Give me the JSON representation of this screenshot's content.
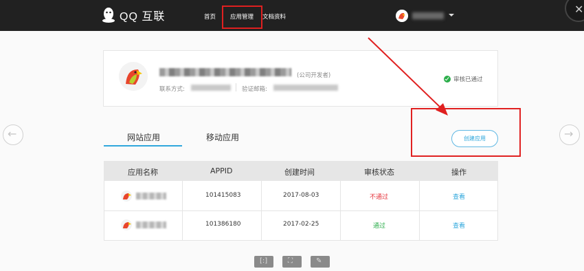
{
  "header": {
    "logo_text": "QQ 互联",
    "nav": {
      "home": "首页",
      "app_manage": "应用管理",
      "docs": "文档资料"
    }
  },
  "profile": {
    "developer_type": "(公司开发者)",
    "contact_label": "联系方式:",
    "email_label": "验证邮箱:",
    "verified_text": "审核已通过"
  },
  "tabs": {
    "web": "网站应用",
    "mobile": "移动应用"
  },
  "create_button": "创建应用",
  "table": {
    "headers": [
      "应用名称",
      "APPID",
      "创建时间",
      "审核状态",
      "操作"
    ],
    "rows": [
      {
        "appid": "101415083",
        "created": "2017-08-03",
        "status": "不通过",
        "action": "查看"
      },
      {
        "appid": "101386180",
        "created": "2017-02-25",
        "status": "通过",
        "action": "查看"
      }
    ]
  },
  "colors": {
    "accent": "#2fa7dc",
    "highlight_box": "#e02020",
    "status_fail": "#e5343c",
    "status_pass": "#2cae4b"
  }
}
